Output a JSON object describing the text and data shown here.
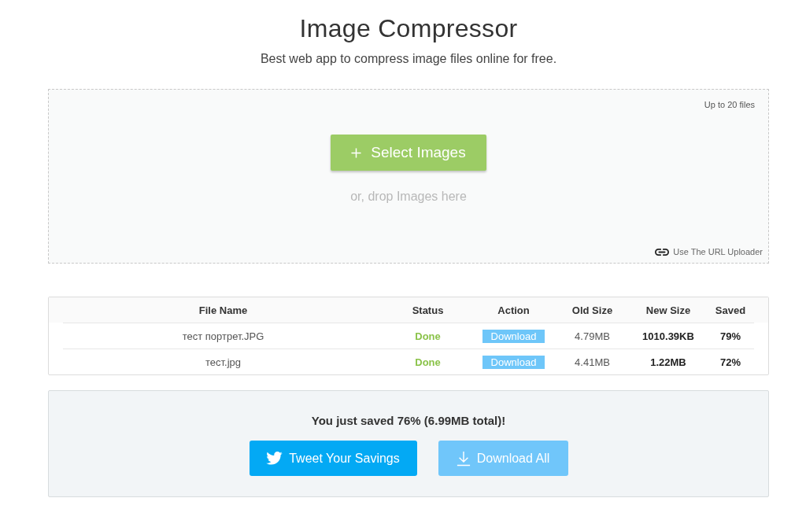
{
  "header": {
    "title": "Image Compressor",
    "subtitle": "Best web app to compress image files online for free."
  },
  "dropzone": {
    "limit_note": "Up to 20 files",
    "select_button": "Select Images",
    "drop_hint": "or, drop Images here",
    "url_uploader_link": "Use The URL Uploader"
  },
  "files_table": {
    "columns": [
      "File Name",
      "Status",
      "Action",
      "Old Size",
      "New Size",
      "Saved"
    ],
    "rows": [
      {
        "file_name": "тест портрет.JPG",
        "status": "Done",
        "action": "Download",
        "old_size": "4.79MB",
        "new_size": "1010.39KB",
        "saved": "79%"
      },
      {
        "file_name": "тест.jpg",
        "status": "Done",
        "action": "Download",
        "old_size": "4.41MB",
        "new_size": "1.22MB",
        "saved": "72%"
      }
    ]
  },
  "summary": {
    "message": "You just saved 76% (6.99MB total)!",
    "buttons": [
      {
        "kind": "tweet",
        "label": "Tweet Your Savings"
      },
      {
        "kind": "download",
        "label": "Download All"
      }
    ]
  }
}
